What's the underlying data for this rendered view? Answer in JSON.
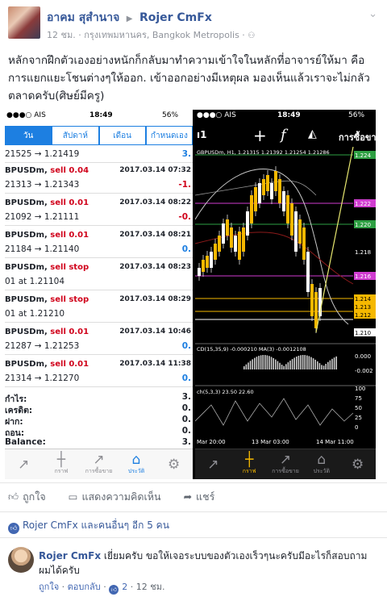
{
  "post": {
    "author": "อาคม สุสำนาจ",
    "arrow": "▶",
    "page": "Rojer CmFx",
    "meta": "12 ชม. · กรุงเทพมหานคร, Bangkok Metropolis · ",
    "text": "หลักจากฝึกตัวเองอย่างหนักก็กลับมาทำความเข้าใจในหลักที่อาจารย์ให้มา คือการแยกแยะโชนต่างๆให้ออก. เข้าออกอย่างมีเหตุผล มองเห็นแล้วเราจะไม่กลัวตลาดครับ(ศิษย์มีครู)"
  },
  "left_phone": {
    "carrier": "●●●○ AIS",
    "time": "18:49",
    "battery": "56%",
    "tabs": [
      "วัน",
      "สัปดาห์",
      "เดือน",
      "กำหนดเอง"
    ],
    "deals": [
      {
        "title": "",
        "type": "",
        "date": "",
        "prices": "21525 → 1.21419",
        "value": "3."
      },
      {
        "title": "BPUSDm,",
        "type": "sell 0.04",
        "date": "2017.03.14 07:32",
        "prices": "21313 → 1.21343",
        "value": "-1."
      },
      {
        "title": "BPUSDm,",
        "type": "sell 0.01",
        "date": "2017.03.14 08:22",
        "prices": "21092 → 1.21111",
        "value": "-0."
      },
      {
        "title": "BPUSDm,",
        "type": "sell 0.01",
        "date": "2017.03.14 08:21",
        "prices": "21184 → 1.21140",
        "value": "0."
      },
      {
        "title": "BPUSDm,",
        "type": "sell stop",
        "date": "2017.03.14 08:23",
        "prices": "01 at 1.21104",
        "value": ""
      },
      {
        "title": "BPUSDm,",
        "type": "sell stop",
        "date": "2017.03.14 08:29",
        "prices": "01 at 1.21210",
        "value": ""
      },
      {
        "title": "BPUSDm,",
        "type": "sell 0.01",
        "date": "2017.03.14 10:46",
        "prices": "21287 → 1.21253",
        "value": "0."
      },
      {
        "title": "BPUSDm,",
        "type": "sell 0.01",
        "date": "2017.03.14 11:38",
        "prices": "21314 → 1.21270",
        "value": "0."
      }
    ],
    "summary": [
      {
        "label": "กำไร:",
        "value": "3."
      },
      {
        "label": "เครดิต:",
        "value": "0."
      },
      {
        "label": "ฝาก:",
        "value": "0."
      },
      {
        "label": "ถอน:",
        "value": "0."
      },
      {
        "label": "Balance:",
        "value": "3."
      }
    ],
    "tabbar": [
      {
        "label": "",
        "icon": "↗"
      },
      {
        "label": "กราฟ",
        "icon": "┼"
      },
      {
        "label": "การซื้อขาย",
        "icon": "↗"
      },
      {
        "label": "ประวัติ",
        "icon": "⌂"
      },
      {
        "label": "",
        "icon": "⚙"
      }
    ]
  },
  "right_phone": {
    "carrier": "●●●○ AIS",
    "time": "18:49",
    "battery": "56%",
    "toolbar_title": "การซื้อขา",
    "header_text": "GBPUSDm, H1, 1.21315 1.21392 1.21254 1.21286",
    "indicator_text": "CD(15,35,9) -0.000210 MA(3) -0.0012108",
    "stoch_text": "ch(5,3,3) 23.50 22.60",
    "price_ticks": [
      "1.224",
      "1.222",
      "1.220",
      "1.218",
      "1.216",
      "1.214",
      "1.213",
      "1.212",
      "1.210"
    ],
    "sub_ticks": [
      "0.000",
      "-0.002",
      "100",
      "75",
      "50",
      "25",
      "0"
    ],
    "x_ticks": [
      "Mar 20:00",
      "13 Mar 03:00",
      "14 Mar 11:00"
    ],
    "tabbar": [
      {
        "label": "",
        "icon": "↗"
      },
      {
        "label": "กราฟ",
        "icon": "┼"
      },
      {
        "label": "การซื้อขาย",
        "icon": "↗"
      },
      {
        "label": "ประวัติ",
        "icon": "⌂"
      },
      {
        "label": "",
        "icon": "⚙"
      }
    ]
  },
  "actions": {
    "like": "ถูกใจ",
    "comment": "แสดงความคิดเห็น",
    "share": "แชร์"
  },
  "likes": "Rojer CmFx และคนอื่นๆ อีก 5 คน",
  "comment": {
    "author": "Rojer CmFx",
    "text": "เยี่ยมครับ ขอให้เจอระบบของตัวเองเร็วๆนะครับมีอะไรก็สอบถามผมได้ครับ",
    "like": "ถูกใจ",
    "reply": "ตอบกลับ",
    "count": "2",
    "time": "12 ชม."
  }
}
